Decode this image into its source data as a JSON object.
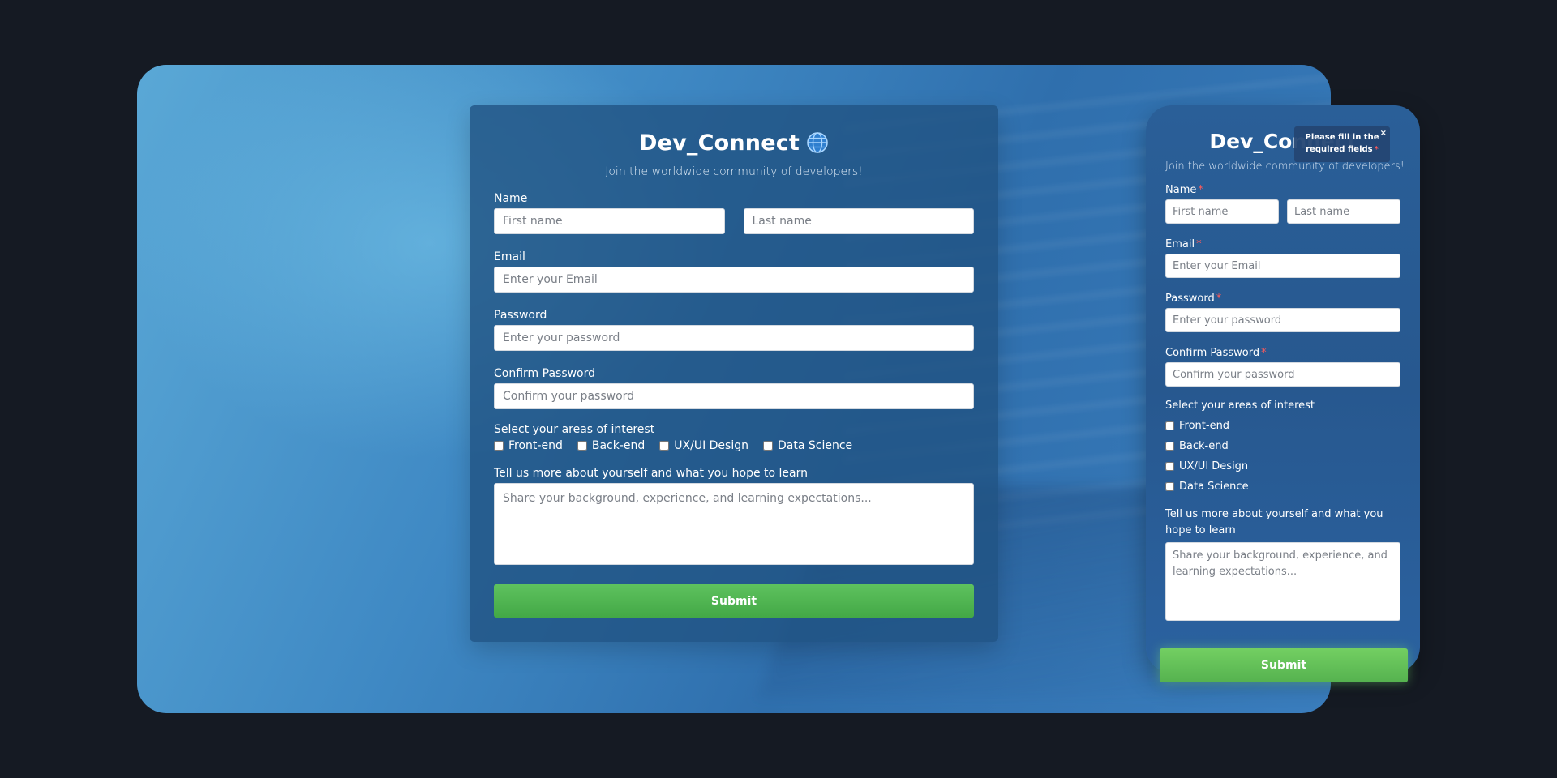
{
  "app": {
    "title": "Dev_Connect",
    "subtitle": "Join the worldwide community of developers!"
  },
  "form": {
    "name_label": "Name",
    "first_name_placeholder": "First name",
    "last_name_placeholder": "Last name",
    "email_label": "Email",
    "email_placeholder": "Enter your Email",
    "password_label": "Password",
    "password_placeholder": "Enter your password",
    "confirm_label": "Confirm Password",
    "confirm_placeholder": "Confirm your password",
    "interests_label": "Select your areas of interest",
    "interests": [
      "Front-end",
      "Back-end",
      "UX/UI Design",
      "Data Science"
    ],
    "about_label": "Tell us more about yourself and what you hope to learn",
    "about_placeholder": "Share your background, experience, and learning expectations...",
    "submit_label": "Submit"
  },
  "mobile": {
    "required_marker": "*",
    "tooltip_line1": "Please fill in the",
    "tooltip_line2": "required fields",
    "tooltip_close": "×"
  },
  "colors": {
    "background": "#151a23",
    "card": "#21527f",
    "submit": "#4caf50",
    "required": "#ff5a5a"
  },
  "icons": {
    "globe": "globe-icon",
    "close": "close-icon"
  }
}
